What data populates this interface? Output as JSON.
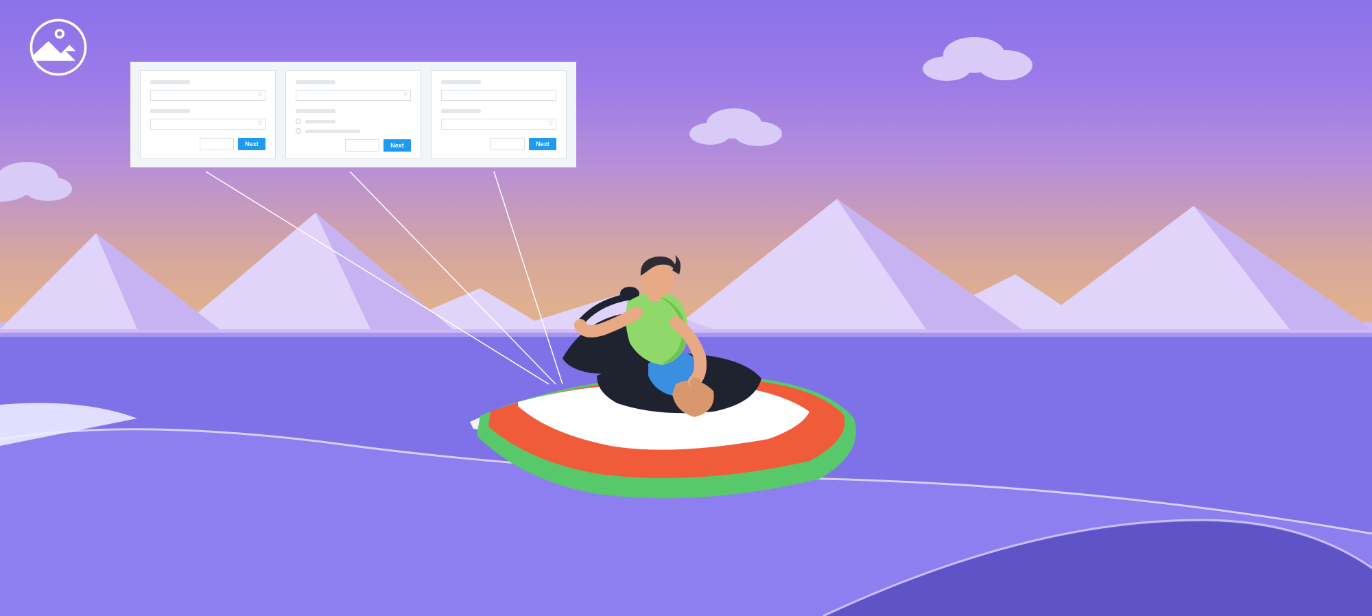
{
  "wizard": {
    "steps": [
      {
        "next_label": "Next",
        "fields": [
          {
            "type": "select"
          },
          {
            "type": "select"
          }
        ]
      },
      {
        "next_label": "Next",
        "fields": [
          {
            "type": "select"
          },
          {
            "type": "radio_group",
            "options": 2
          }
        ]
      },
      {
        "next_label": "Next",
        "fields": [
          {
            "type": "text"
          },
          {
            "type": "select"
          }
        ]
      }
    ]
  },
  "colors": {
    "primary_button": "#1e9bf0",
    "sky_top": "#8a72ea",
    "sky_bottom": "#e3b38a",
    "water": "#7f72e8",
    "mountain_light": "#e1d4fa",
    "mountain_dark": "#c7b2f2",
    "jetski_body": "#f05b3a",
    "jetski_accent": "#57c96a",
    "rider_skin": "#e8a985",
    "rider_hair": "#2f2c33",
    "rider_top": "#8fd96a",
    "rider_shorts": "#3a8fe0"
  }
}
